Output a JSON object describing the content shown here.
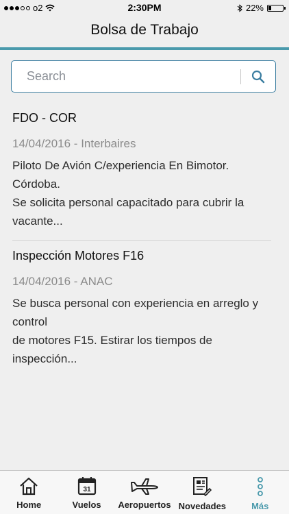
{
  "status_bar": {
    "carrier": "o2",
    "time": "2:30PM",
    "battery": "22%",
    "battery_level": 0.22
  },
  "nav": {
    "title": "Bolsa de Trabajo"
  },
  "search": {
    "placeholder": "Search",
    "value": ""
  },
  "jobs": [
    {
      "title": "FDO - COR",
      "meta": "14/04/2016 - Interbaires",
      "line1": "Piloto De Avión C/experiencia En Bimotor. Córdoba.",
      "line2": "Se solicita personal capacitado para cubrir la vacante..."
    },
    {
      "title": "Inspección Motores F16",
      "meta": "14/04/2016 - ANAC",
      "line1": "Se busca personal con experiencia en arreglo y control",
      "line2": "de motores F15. Estirar los tiempos de inspección..."
    }
  ],
  "tabs": [
    {
      "label": "Home",
      "icon": "home-icon"
    },
    {
      "label": "Vuelos",
      "icon": "calendar-icon",
      "icon_text": "31"
    },
    {
      "label": "Aeropuertos",
      "icon": "airplane-icon"
    },
    {
      "label": "Novedades",
      "icon": "news-icon"
    },
    {
      "label": "Más",
      "icon": "more-icon",
      "active": true
    }
  ],
  "colors": {
    "accent": "#4a9aac",
    "search_border": "#3a7da0",
    "background": "#efefef"
  }
}
